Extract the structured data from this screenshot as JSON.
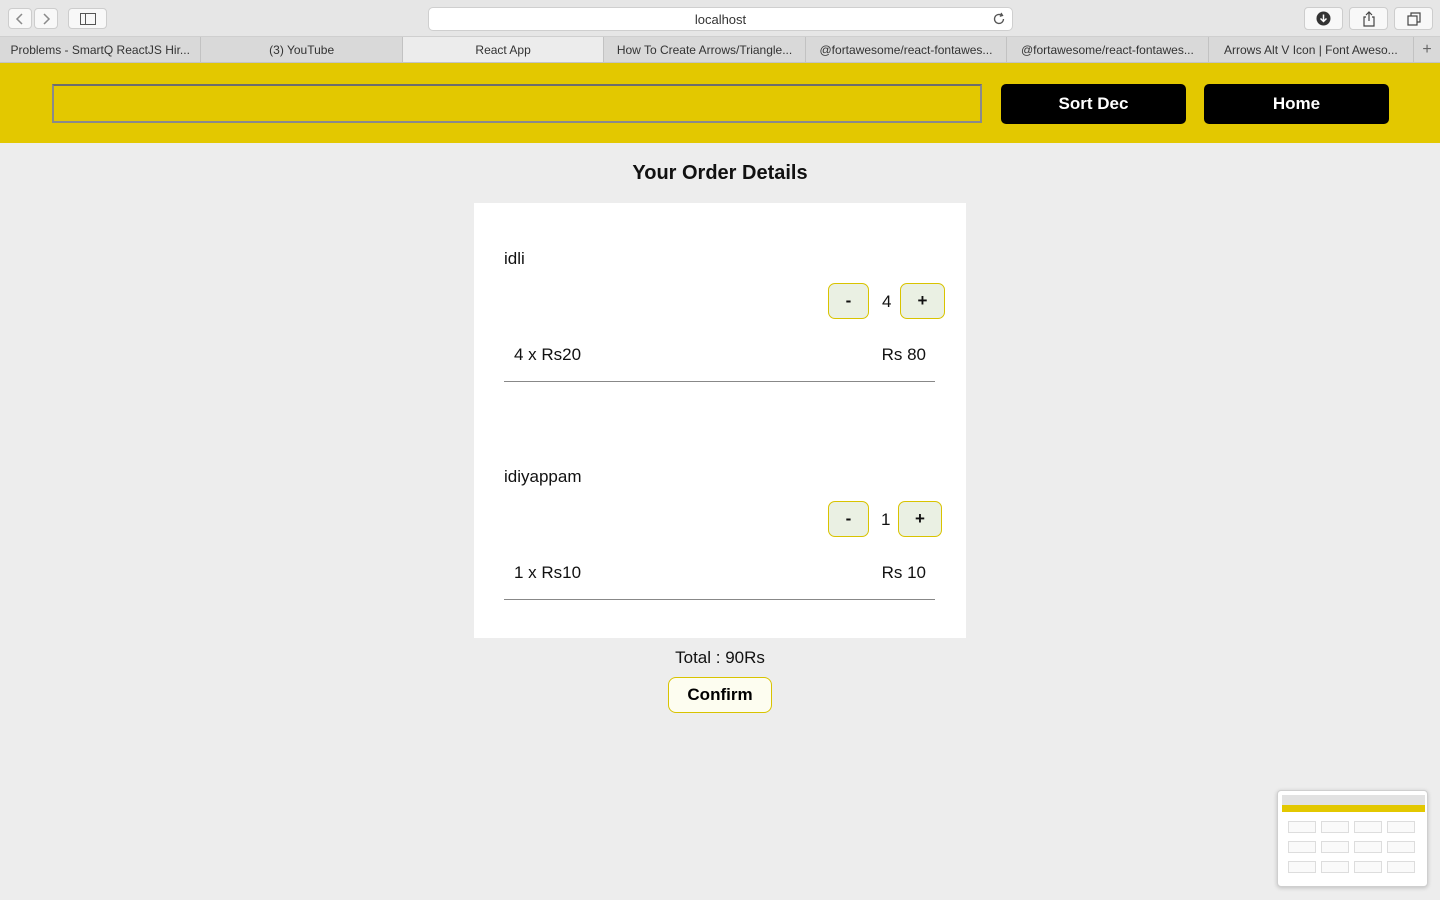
{
  "browser": {
    "address": "localhost",
    "tabs": [
      {
        "label": "Problems - SmartQ ReactJS Hir...",
        "active": false
      },
      {
        "label": "(3) YouTube",
        "active": false
      },
      {
        "label": "React App",
        "active": true
      },
      {
        "label": "How To Create Arrows/Triangle...",
        "active": false
      },
      {
        "label": "@fortawesome/react-fontawes...",
        "active": false
      },
      {
        "label": "@fortawesome/react-fontawes...",
        "active": false
      },
      {
        "label": "Arrows Alt V Icon | Font Aweso...",
        "active": false
      }
    ],
    "new_tab_label": "+"
  },
  "header": {
    "search_value": "",
    "sort_label": "Sort Dec",
    "home_label": "Home",
    "accent_color": "#e3c800"
  },
  "page": {
    "title": "Your Order Details"
  },
  "order": {
    "items": [
      {
        "name": "idli",
        "decrement_label": "-",
        "quantity": "4",
        "increment_label": "+",
        "calc": "4 x Rs20",
        "price": "Rs 80"
      },
      {
        "name": "idiyappam",
        "decrement_label": "-",
        "quantity": "1",
        "increment_label": "+",
        "calc": "1 x Rs10",
        "price": "Rs 10"
      }
    ],
    "total": "Total : 90Rs",
    "confirm_label": "Confirm"
  }
}
